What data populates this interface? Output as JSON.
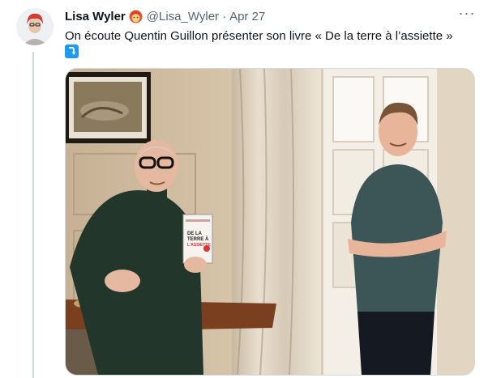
{
  "tweet": {
    "author_name": "Lisa Wyler",
    "handle": "@Lisa_Wyler",
    "separator": "·",
    "date": "Apr 27",
    "text": "On écoute Quentin Guillon présenter son livre « De la terre à l’assiette »",
    "more_label": "···",
    "name_badge_icon": "red-haired-woman-emoji",
    "text_emoji_icon": "right-arrow-curving-down-emoji"
  },
  "media": {
    "description_icon": "photo",
    "book_cover": {
      "title_lines": [
        "DE LA",
        "TERRE À",
        "L'ASSIETTE"
      ]
    }
  },
  "colors": {
    "text": "#0f1419",
    "secondary": "#536471",
    "border": "#cfd9de",
    "emoji_blue": "#1d9bf0"
  }
}
